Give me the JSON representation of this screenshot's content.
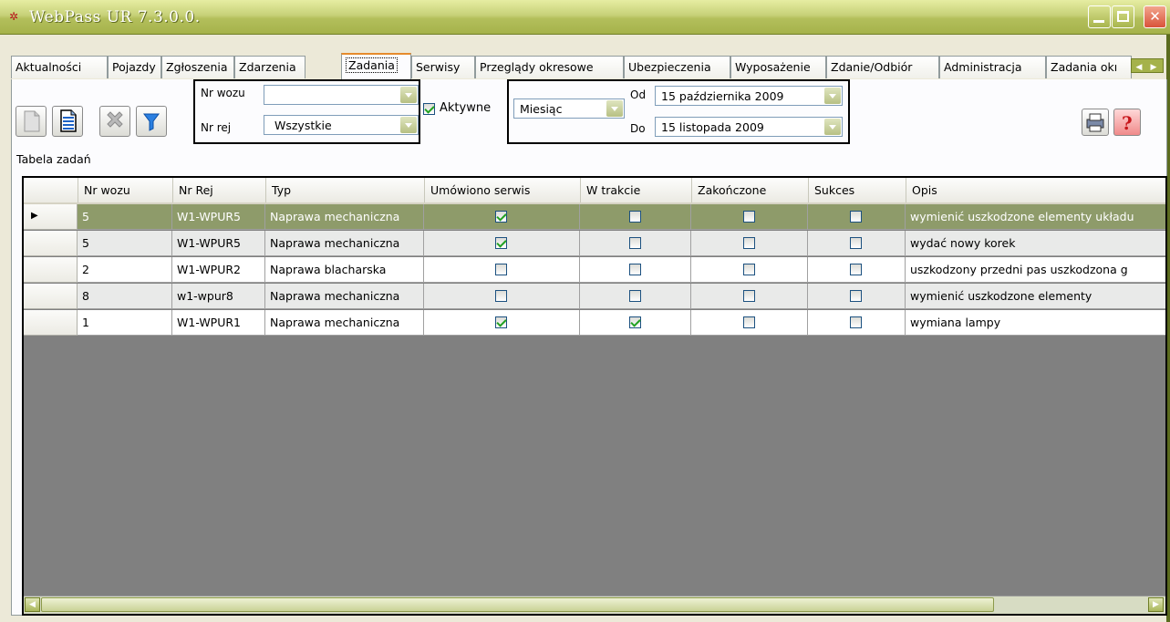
{
  "window": {
    "title": "WebPass UR 7.3.0.0.",
    "icon": "app-logo-icon"
  },
  "tabs": [
    {
      "label": "Aktualności"
    },
    {
      "label": "Pojazdy"
    },
    {
      "label": "Zgłoszenia"
    },
    {
      "label": "Zdarzenia"
    },
    {
      "label": "Zadania",
      "active": true
    },
    {
      "label": "Serwisy"
    },
    {
      "label": "Przeglądy okresowe"
    },
    {
      "label": "Ubezpieczenia"
    },
    {
      "label": "Wyposażenie"
    },
    {
      "label": "Zdanie/Odbiór"
    },
    {
      "label": "Administracja"
    },
    {
      "label": "Zadania okı"
    }
  ],
  "toolbar": {
    "buttons": [
      "new-document-icon",
      "document-icon",
      "delete-icon",
      "filter-icon",
      "print-icon",
      "help-icon"
    ]
  },
  "filters": {
    "nr_wozu_label": "Nr wozu",
    "nr_wozu_value": "",
    "nr_rej_label": "Nr rej",
    "nr_rej_value": "Wszystkie",
    "aktywne_label": "Aktywne",
    "aktywne_checked": true,
    "period_value": "Miesiąc",
    "od_label": "Od",
    "od_value": "15 października 2009",
    "do_label": "Do",
    "do_value": "15  listopada  2009"
  },
  "table": {
    "caption": "Tabela zadań",
    "columns": [
      "Nr wozu",
      "Nr Rej",
      "Typ",
      "Umówiono serwis",
      "W trakcie",
      "Zakończone",
      "Sukces",
      "Opis"
    ],
    "rows": [
      {
        "nr_wozu": "5",
        "nr_rej": "W1-WPUR5",
        "typ": "Naprawa mechaniczna",
        "umowiono": true,
        "w_trakcie": false,
        "zakonczone": false,
        "sukces": false,
        "opis": "wymienić uszkodzone elementy układu"
      },
      {
        "nr_wozu": "5",
        "nr_rej": "W1-WPUR5",
        "typ": "Naprawa mechaniczna",
        "umowiono": true,
        "w_trakcie": false,
        "zakonczone": false,
        "sukces": false,
        "opis": "wydać nowy korek"
      },
      {
        "nr_wozu": "2",
        "nr_rej": "W1-WPUR2",
        "typ": "Naprawa blacharska",
        "umowiono": false,
        "w_trakcie": false,
        "zakonczone": false,
        "sukces": false,
        "opis": "uszkodzony przedni pas  uszkodzona g"
      },
      {
        "nr_wozu": "8",
        "nr_rej": "w1-wpur8",
        "typ": "Naprawa mechaniczna",
        "umowiono": false,
        "w_trakcie": false,
        "zakonczone": false,
        "sukces": false,
        "opis": "wymienić uszkodzone elementy"
      },
      {
        "nr_wozu": "1",
        "nr_rej": "W1-WPUR1",
        "typ": "Naprawa mechaniczna",
        "umowiono": true,
        "w_trakcie": true,
        "zakonczone": false,
        "sukces": false,
        "opis": "wymiana lampy"
      }
    ]
  },
  "colors": {
    "titlebar": "#b3bf5b",
    "selected_row": "#8e9b6a",
    "grid_background": "#808080",
    "active_tab_accent": "#e68b2c"
  }
}
